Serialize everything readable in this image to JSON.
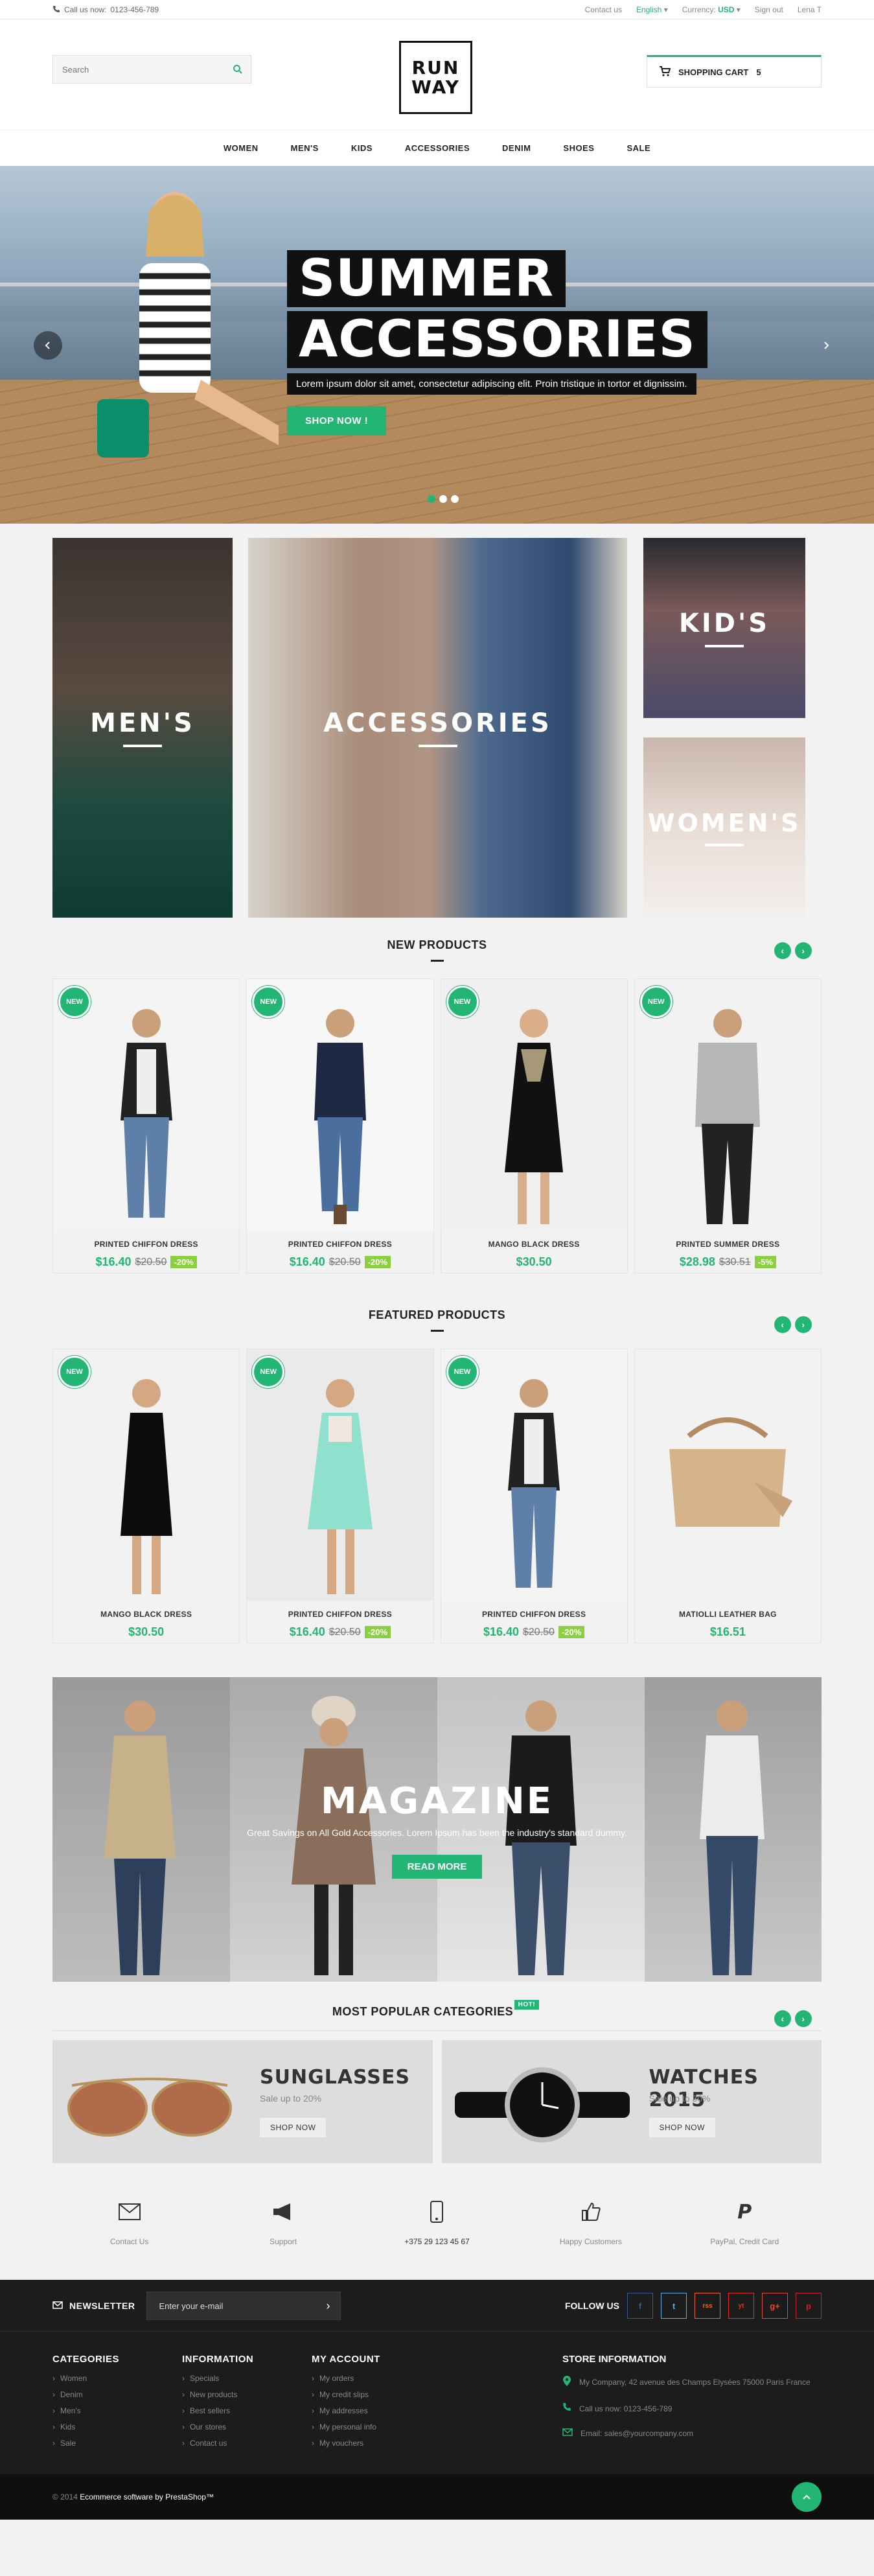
{
  "topbar": {
    "phone_label": "Call us now: ",
    "phone_number": "0123-456-789",
    "contact": "Contact us",
    "language": "English",
    "currency_label": "Currency:",
    "currency": "USD",
    "signout": "Sign out",
    "user": "Lena T"
  },
  "header": {
    "search_placeholder": "Search",
    "logo_line1": "RUN",
    "logo_line2": "WAY",
    "cart_label": "SHOPPING CART",
    "cart_count": "5"
  },
  "nav": [
    "WOMEN",
    "MEN'S",
    "KIDS",
    "ACCESSORIES",
    "DENIM",
    "SHOES",
    "SALE"
  ],
  "hero": {
    "line1": "SUMMER",
    "line2": "ACCESSORIES",
    "subtitle": "Lorem ipsum dolor sit amet, consectetur adipiscing elit. Proin tristique in tortor et dignissim.",
    "cta": "SHOP NOW !"
  },
  "banners": {
    "mens": "MEN'S",
    "accessories": "ACCESSORIES",
    "kids": "KID'S",
    "womens": "WOMEN'S"
  },
  "new_products": {
    "title": "NEW PRODUCTS",
    "badge": "NEW",
    "items": [
      {
        "name": "PRINTED CHIFFON DRESS",
        "price": "$16.40",
        "old": "$20.50",
        "discount": "-20%"
      },
      {
        "name": "PRINTED CHIFFON DRESS",
        "price": "$16.40",
        "old": "$20.50",
        "discount": "-20%"
      },
      {
        "name": "MANGO BLACK DRESS",
        "price": "$30.50",
        "old": "",
        "discount": ""
      },
      {
        "name": "PRINTED SUMMER DRESS",
        "price": "$28.98",
        "old": "$30.51",
        "discount": "-5%"
      }
    ]
  },
  "featured_products": {
    "title": "FEATURED PRODUCTS",
    "items": [
      {
        "name": "MANGO BLACK DRESS",
        "price": "$30.50",
        "old": "",
        "discount": ""
      },
      {
        "name": "PRINTED CHIFFON DRESS",
        "price": "$16.40",
        "old": "$20.50",
        "discount": "-20%"
      },
      {
        "name": "PRINTED CHIFFON DRESS",
        "price": "$16.40",
        "old": "$20.50",
        "discount": "-20%"
      },
      {
        "name": "MATIOLLI LEATHER BAG",
        "price": "$16.51",
        "old": "",
        "discount": ""
      }
    ]
  },
  "magazine": {
    "title": "MAGAZINE",
    "text": "Great Savings on All Gold Accessories. Lorem Ipsum has been the industry's standard dummy.",
    "cta": "READ MORE"
  },
  "popular": {
    "title": "MOST POPULAR CATEGORIES",
    "hot": "HOT!",
    "items": [
      {
        "title": "SUNGLASSES",
        "sub": "Sale up to 20%",
        "cta": "SHOP NOW"
      },
      {
        "title": "WATCHES 2015",
        "sub": "Sale up to 30%",
        "cta": "SHOP NOW"
      }
    ]
  },
  "services": [
    "Contact Us",
    "Support",
    "+375 29 123 45 67",
    "Happy Customers",
    "PayPal, Credit Card"
  ],
  "footer": {
    "newsletter": "NEWSLETTER",
    "newsletter_placeholder": "Enter your e-mail",
    "follow": "FOLLOW US",
    "social": [
      "f",
      "t",
      "rss",
      "yt",
      "g+",
      "p"
    ],
    "categories": {
      "title": "CATEGORIES",
      "items": [
        "Women",
        "Denim",
        "Men's",
        "Kids",
        "Sale"
      ]
    },
    "information": {
      "title": "INFORMATION",
      "items": [
        "Specials",
        "New products",
        "Best sellers",
        "Our stores",
        "Contact us"
      ]
    },
    "account": {
      "title": "MY ACCOUNT",
      "items": [
        "My orders",
        "My credit slips",
        "My addresses",
        "My personal info",
        "My vouchers"
      ]
    },
    "store": {
      "title": "STORE INFORMATION",
      "address": "My Company, 42 avenue des Champs Elysées 75000 Paris France",
      "phone": "Call us now: 0123-456-789",
      "email": "Email: sales@yourcompany.com"
    },
    "copyright_prefix": "© 2014",
    "copyright_text": "Ecommerce software by PrestaShop™"
  },
  "colors": {
    "accent": "#22b573",
    "dark": "#1c1c1c"
  }
}
